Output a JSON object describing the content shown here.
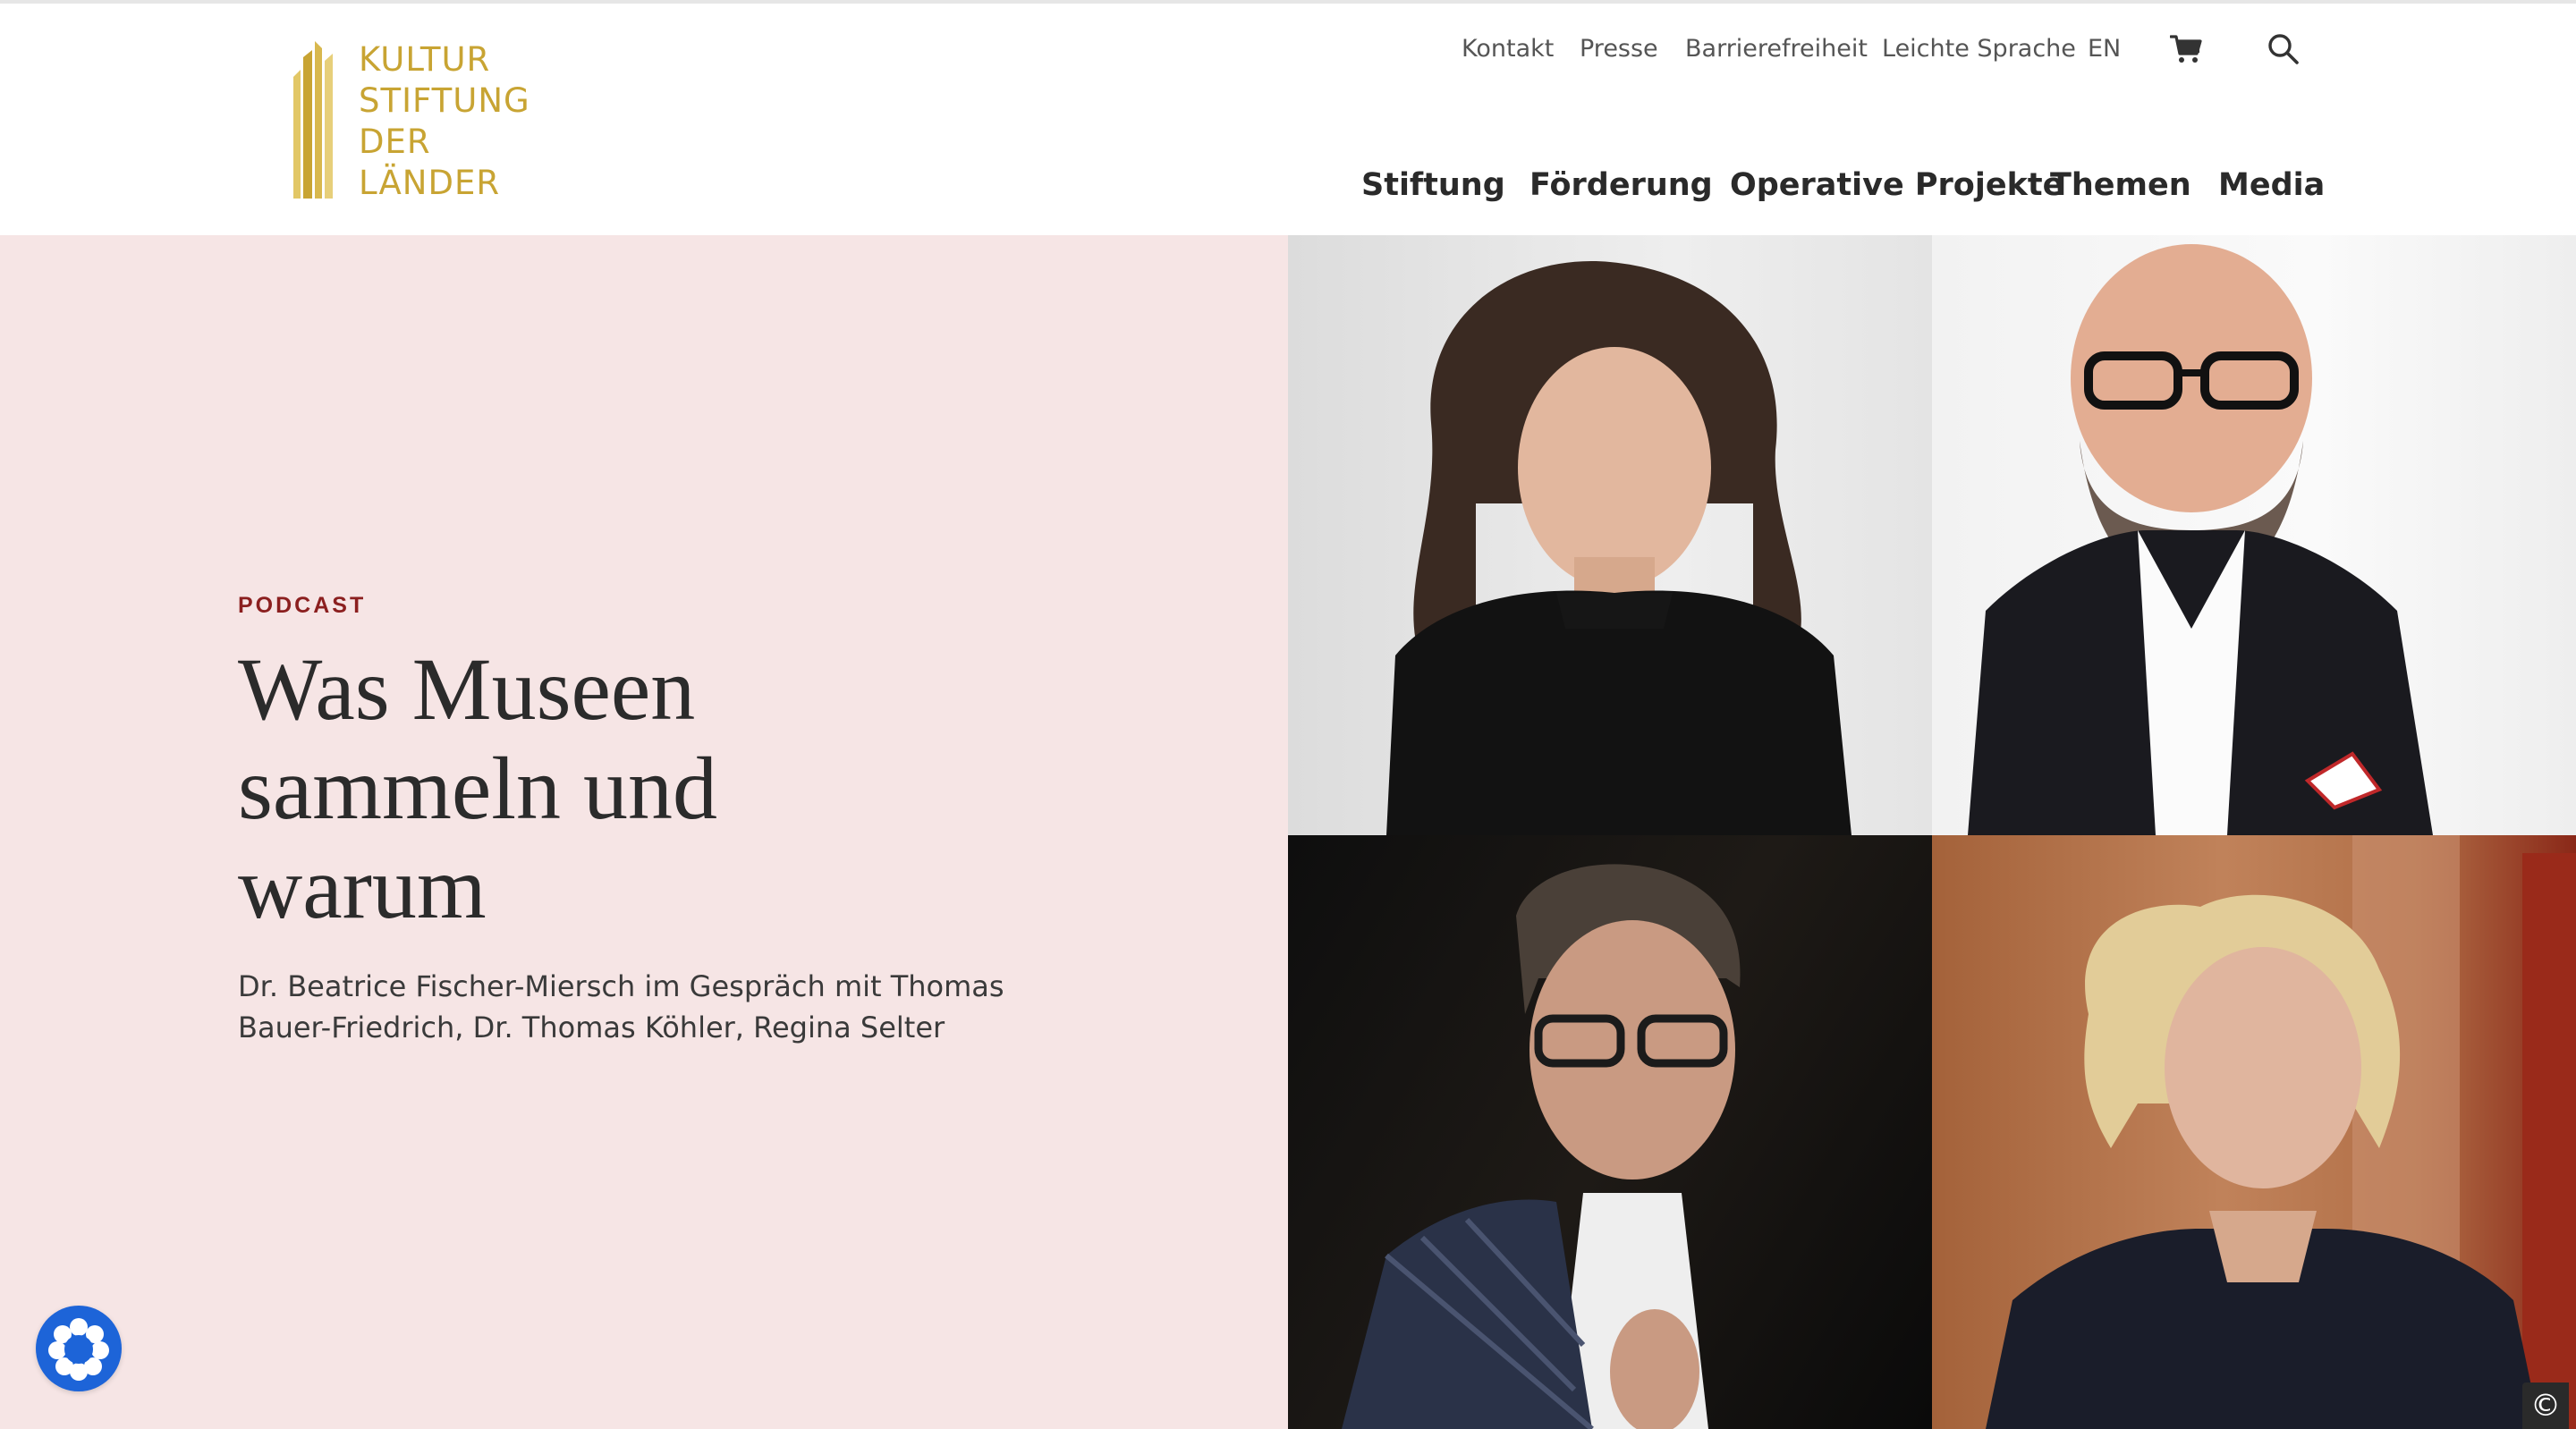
{
  "logo": {
    "lines": [
      "KULTUR",
      "STIFTUNG",
      "DER",
      "LÄNDER"
    ]
  },
  "utility_nav": [
    "Kontakt",
    "Presse",
    "Barrierefreiheit",
    "Leichte Sprache",
    "EN"
  ],
  "icons": {
    "cart": "shopping-cart-icon",
    "search": "search-icon",
    "fab": "accessibility-widget-icon",
    "copyright": "copyright-icon"
  },
  "main_nav": [
    "Stiftung",
    "Förderung",
    "Operative Projekte",
    "Themen",
    "Media"
  ],
  "hero": {
    "eyebrow": "PODCAST",
    "title_lines": [
      "Was Museen",
      "sammeln und",
      "warum"
    ],
    "subtitle_lines": [
      "Dr. Beatrice Fischer-Miersch im Gespräch mit Thomas",
      "Bauer-Friedrich, Dr. Thomas Köhler, Regina Selter"
    ]
  },
  "copyright_symbol": "©",
  "colors": {
    "brand_gold": "#c8a433",
    "hero_bg": "#f6e5e5",
    "eyebrow": "#8b1f1f",
    "fab": "#1d64d8"
  }
}
